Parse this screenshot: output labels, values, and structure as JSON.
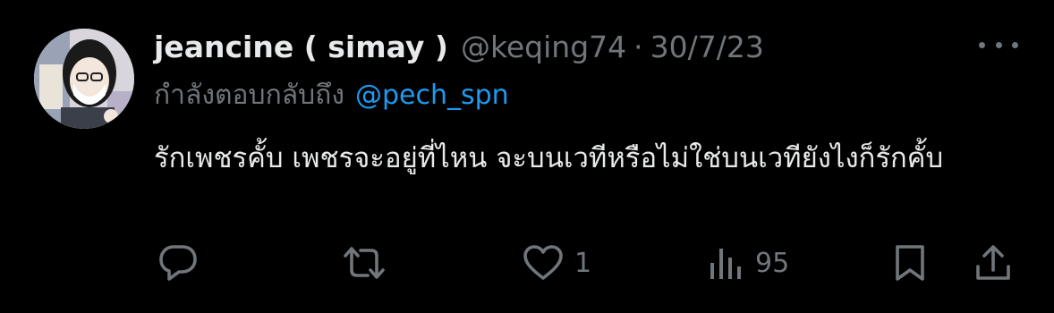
{
  "tweet": {
    "display_name": "jeancine ( simay )",
    "handle": "@keqing74",
    "separator": "·",
    "date": "30/7/23",
    "reply_prefix": "กำลังตอบกลับถึง",
    "reply_mention": "@pech_spn",
    "body": "รักเพชรคั้บ เพชรจะอยู่ที่ไหน จะบนเวทีหรือไม่ใช่บนเวทียังไงก็รักคั้บ"
  },
  "actions": {
    "reply_icon": "reply-icon",
    "retweet_icon": "retweet-icon",
    "like_icon": "heart-icon",
    "like_count": "1",
    "views_icon": "views-icon",
    "views_count": "95",
    "bookmark_icon": "bookmark-icon",
    "share_icon": "share-icon"
  },
  "colors": {
    "background": "#000000",
    "text": "#e7e9ea",
    "muted": "#71767b",
    "link": "#1d9bf0"
  }
}
